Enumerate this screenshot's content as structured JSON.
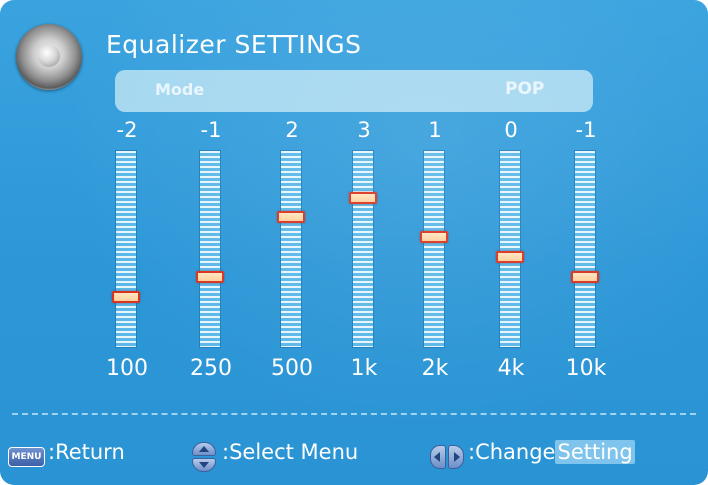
{
  "header": {
    "title": "Equalizer SETTINGS",
    "icon": "speaker-icon"
  },
  "mode": {
    "label": "Mode",
    "value": "POP"
  },
  "equalizer": {
    "range": [
      -5,
      5
    ],
    "bands": [
      {
        "freq": "100",
        "value": "-2",
        "level": -2
      },
      {
        "freq": "250",
        "value": "-1",
        "level": -1
      },
      {
        "freq": "500",
        "value": "2",
        "level": 2
      },
      {
        "freq": "1k",
        "value": "3",
        "level": 3
      },
      {
        "freq": "2k",
        "value": "1",
        "level": 1
      },
      {
        "freq": "4k",
        "value": "0",
        "level": 0
      },
      {
        "freq": "10k",
        "value": "-1",
        "level": -1
      }
    ]
  },
  "footer": {
    "menu_key": "MENU",
    "return_label": ":Return",
    "select_label": ":Select Menu",
    "change_label": ":Change",
    "setting_label": "Setting"
  },
  "colors": {
    "background": "#2c97d7",
    "mode_bar": "#a5d8f0",
    "knob_border": "#d9331e"
  }
}
